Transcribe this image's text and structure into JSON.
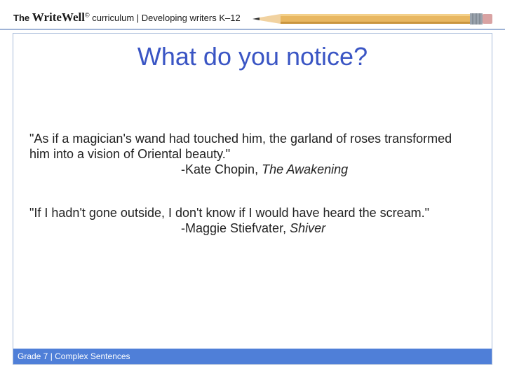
{
  "header": {
    "brand_prefix": "The",
    "brand_name": "WriteWell",
    "brand_mark": "©",
    "subtitle": " curriculum | Developing writers K–12"
  },
  "slide": {
    "title": "What do you notice?",
    "quotes": [
      {
        "text": "\"As if a magician's wand had touched him, the garland of roses transformed him into a vision of Oriental beauty.\"",
        "attribution_prefix": "-Kate Chopin, ",
        "work": "The Awakening"
      },
      {
        "text": "\"If I hadn't gone outside, I don't know if I would have heard the scream.\"",
        "attribution_prefix": "-Maggie Stiefvater, ",
        "work": "Shiver"
      }
    ]
  },
  "footer": {
    "label": "Grade 7 | Complex Sentences"
  },
  "colors": {
    "title": "#3a55c4",
    "footer_bar": "#4f7fd8",
    "frame_border": "#a7bad9",
    "pencil_body": "#e8b761"
  }
}
